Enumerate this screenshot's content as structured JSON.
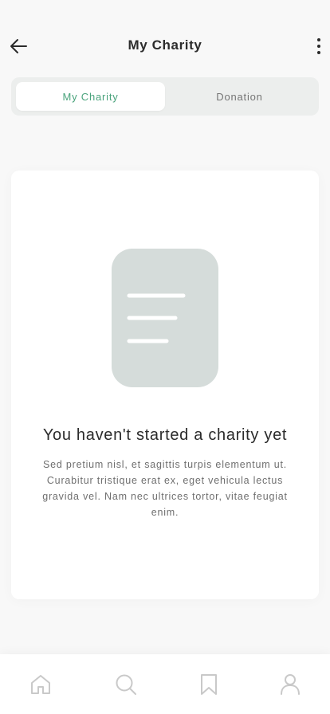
{
  "header": {
    "title": "My Charity",
    "back_icon": "arrow-left-icon",
    "more_icon": "more-vertical-icon"
  },
  "tabs": [
    {
      "label": "My Charity",
      "active": true
    },
    {
      "label": "Donation",
      "active": false
    }
  ],
  "empty_state": {
    "illustration": "document-icon",
    "title": "You haven't started a charity yet",
    "description": "Sed pretium nisl, et sagittis turpis elementum ut. Curabitur tristique erat ex, eget vehicula lectus gravida vel. Nam nec ultrices tortor, vitae feugiat enim."
  },
  "bottom_nav": [
    {
      "icon": "home-icon"
    },
    {
      "icon": "search-icon"
    },
    {
      "icon": "bookmark-icon"
    },
    {
      "icon": "profile-icon"
    }
  ],
  "colors": {
    "accent": "#4aa37c",
    "background": "#f8f8f8",
    "tab_track": "#eceeed",
    "illustration": "#d5dcda",
    "nav_icon": "#c9c9c9"
  }
}
